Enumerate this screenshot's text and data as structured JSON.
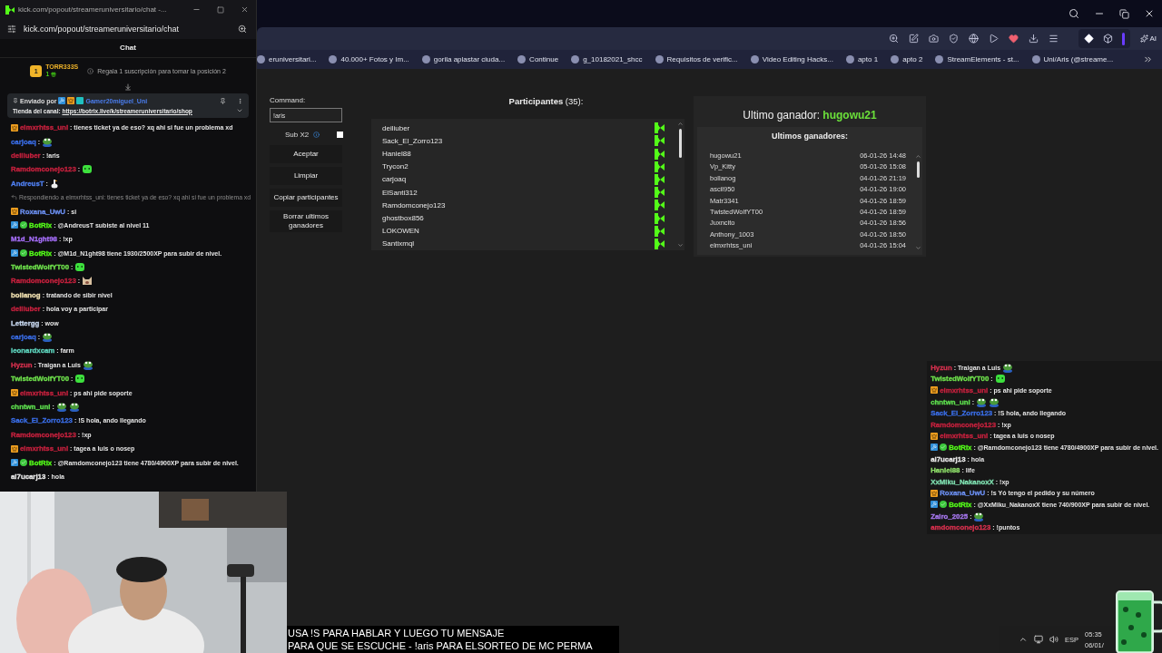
{
  "browser": {
    "ai_label": "AI",
    "bookmarks": [
      "eruniversitari...",
      "40.000+ Fotos y Im...",
      "gorila aplastar ciuda...",
      "Continue",
      "g_10182021_shcc",
      "Requisitos de verific...",
      "Video Editing Hacks...",
      "apto 1",
      "apto 2",
      "StreamElements - st...",
      "Uni/Aris (@streame..."
    ]
  },
  "panel": {
    "command_label": "Command:",
    "command_value": "!aris",
    "sub_label": "Sub X2",
    "sub_checked": false,
    "buttons": [
      "Aceptar",
      "Limpiar",
      "Copiar participantes",
      "Borrar ultimos ganadores"
    ],
    "participants_title": "**Participantes** (35):",
    "participants": [
      "deiliuber",
      "Sack_El_Zorro123",
      "Haniel88",
      "Trycon2",
      "carjoaq",
      "ElSanti312",
      "Ramdomconejo123",
      "ghostbox856",
      "LOKOWEN",
      "Santixmql"
    ],
    "winner_label": "Ultimo ganador: ",
    "winner": "hugowu21",
    "winners_title": "Ultimos ganadores:",
    "winners": [
      {
        "name": "hugowu21",
        "date": "06-01-26 14:48"
      },
      {
        "name": "Vp_Kitty",
        "date": "05-01-26 15:08"
      },
      {
        "name": "bollanog",
        "date": "04-01-26 21:19"
      },
      {
        "name": "ascil950",
        "date": "04-01-26 19:00"
      },
      {
        "name": "Matr3341",
        "date": "04-01-26 18:59"
      },
      {
        "name": "TwistedWolfYT00",
        "date": "04-01-26 18:59"
      },
      {
        "name": "Juxncito",
        "date": "04-01-26 18:56"
      },
      {
        "name": "Anthony_1003",
        "date": "04-01-26 18:50"
      },
      {
        "name": "elmxrhtss_uni",
        "date": "04-01-26 15:04"
      }
    ]
  },
  "chat_window": {
    "title": "kick.com/popout/streameruniversitario/chat -...",
    "address": "kick.com/popout/streameruniversitario/chat",
    "header": "Chat",
    "leader": {
      "rank": "1",
      "name": "TORR333S",
      "count": "1",
      "hint": "Regala 1 suscripción para tomar la posición 2"
    },
    "pinned": {
      "label": "Enviado por",
      "user": "Gamer20miguel_Uni",
      "text": "Tienda del canal: ",
      "link": "https://botrix.live/k/streameruniversitario/shop"
    },
    "messages": [
      {
        "kind": "message",
        "badges": [
          {
            "kind": "crown"
          }
        ],
        "user": "elmxrhtss_uni",
        "color": "#c8213e",
        "text": ": tienes ticket ya de eso? xq ahi si fue un problema xd"
      },
      {
        "kind": "message",
        "user": "carjoaq",
        "color": "#3a6ee8",
        "text": ":",
        "emotes": [
          {
            "kind": "frog"
          }
        ]
      },
      {
        "kind": "message",
        "user": "deiliuber",
        "color": "#c8213e",
        "text": ": !aris"
      },
      {
        "kind": "message",
        "user": "Ramdomconejo123",
        "color": "#c8213e",
        "text": ":",
        "emotes": [
          {
            "kind": "slime"
          }
        ]
      },
      {
        "kind": "message",
        "user": "AndreusT",
        "color": "#4f7ff0",
        "text": ":",
        "emotes": [
          {
            "kind": "goose"
          }
        ]
      },
      {
        "kind": "reply",
        "text": "Respondiendo a elmxrhtss_uni: tienes ticket ya de eso? xq ahi si fue un problema xd"
      },
      {
        "kind": "message",
        "badges": [
          {
            "kind": "crown"
          }
        ],
        "user": "Roxana_UwU",
        "color": "#6b8ff0",
        "text": ": si"
      },
      {
        "kind": "message",
        "badges": [
          {
            "kind": "botrix"
          },
          {
            "kind": "verified"
          }
        ],
        "user": "BotRix",
        "color": "#53fc18",
        "text": ": @AndreusT subiste al nivel 11"
      },
      {
        "kind": "message",
        "user": "M1d_N1ght98",
        "color": "#a970ff",
        "text": ": !xp"
      },
      {
        "kind": "message",
        "badges": [
          {
            "kind": "botrix"
          },
          {
            "kind": "verified"
          }
        ],
        "user": "BotRix",
        "color": "#53fc18",
        "text": ": @M1d_N1ght98 tiene 1930/2500XP para subir de nivel."
      },
      {
        "kind": "message",
        "user": "TwistedWolfYT00",
        "color": "#6fe34c",
        "text": ":",
        "emotes": [
          {
            "kind": "slime"
          }
        ]
      },
      {
        "kind": "message",
        "user": "Ramdomconejo123",
        "color": "#c8213e",
        "text": ":",
        "emotes": [
          {
            "kind": "cat"
          }
        ]
      },
      {
        "kind": "message",
        "user": "bollanog",
        "color": "#f0e0b0",
        "text": ": tratando de sibir nivel"
      },
      {
        "kind": "message",
        "user": "deiliuber",
        "color": "#c8213e",
        "text": ": hola voy a participar"
      },
      {
        "kind": "message",
        "user": "Lettergg",
        "color": "#c8d8f0",
        "text": ": wow"
      },
      {
        "kind": "message",
        "user": "carjoaq",
        "color": "#3a6ee8",
        "text": ":",
        "emotes": [
          {
            "kind": "frog"
          }
        ]
      },
      {
        "kind": "message",
        "user": "leonardxcam",
        "color": "#5fd8c0",
        "text": ": farm"
      },
      {
        "kind": "message",
        "user": "Hyzun",
        "color": "#d8304e",
        "text": ": Traigan a Luis",
        "emotes": [
          {
            "kind": "frog"
          }
        ]
      },
      {
        "kind": "message",
        "user": "TwistedWolfYT00",
        "color": "#6fe34c",
        "text": ":",
        "emotes": [
          {
            "kind": "slime"
          }
        ]
      },
      {
        "kind": "message",
        "badges": [
          {
            "kind": "crown"
          }
        ],
        "user": "elmxrhtss_uni",
        "color": "#c8213e",
        "text": ": ps ahi pide soporte"
      },
      {
        "kind": "message",
        "user": "chntwn_uni",
        "color": "#5ee04e",
        "text": ":",
        "emotes": [
          {
            "kind": "frog"
          },
          {
            "kind": "frog"
          }
        ]
      },
      {
        "kind": "message",
        "user": "Sack_El_Zorro123",
        "color": "#3a6ee8",
        "text": ": !S hola, ando llegando"
      },
      {
        "kind": "message",
        "user": "Ramdomconejo123",
        "color": "#c8213e",
        "text": ": !xp"
      },
      {
        "kind": "message",
        "badges": [
          {
            "kind": "crown"
          }
        ],
        "user": "elmxrhtss_uni",
        "color": "#c8213e",
        "text": ": tagea a luis o nosep"
      },
      {
        "kind": "message",
        "badges": [
          {
            "kind": "botrix"
          },
          {
            "kind": "verified"
          }
        ],
        "user": "BotRix",
        "color": "#53fc18",
        "text": ": @Ramdomconejo123 tiene 4780/4900XP para subir de nivel."
      },
      {
        "kind": "message",
        "user": "al7ucarj13",
        "color": "#e8e8e8",
        "text": ": hola"
      }
    ]
  },
  "overlay_chat": {
    "messages": [
      {
        "kind": "message",
        "user": "Hyzun",
        "color": "#d8304e",
        "text": " : Traigan a Luis",
        "emotes": [
          {
            "kind": "frog"
          }
        ]
      },
      {
        "kind": "message",
        "user": "TwistedWolfYT00",
        "color": "#6fe34c",
        "text": " :",
        "emotes": [
          {
            "kind": "slime"
          }
        ]
      },
      {
        "kind": "message",
        "badges": [
          {
            "kind": "crown"
          }
        ],
        "user": "elmxrhtss_uni",
        "color": "#c8213e",
        "text": " : ps ahi pide soporte"
      },
      {
        "kind": "message",
        "user": "chntwn_uni",
        "color": "#5ee04e",
        "text": " :",
        "emotes": [
          {
            "kind": "frog"
          },
          {
            "kind": "frog"
          }
        ]
      },
      {
        "kind": "message",
        "user": "Sack_El_Zorro123",
        "color": "#3a6ee8",
        "text": " : !S hola, ando llegando"
      },
      {
        "kind": "message",
        "user": "Ramdomconejo123",
        "color": "#c8213e",
        "text": " : !xp"
      },
      {
        "kind": "message",
        "badges": [
          {
            "kind": "crown"
          }
        ],
        "user": "elmxrhtss_uni",
        "color": "#c8213e",
        "text": " : tagea a luis o nosep"
      },
      {
        "kind": "message",
        "badges": [
          {
            "kind": "botrix"
          },
          {
            "kind": "verified"
          }
        ],
        "user": "BotRix",
        "color": "#53fc18",
        "text": " : @Ramdomconejo123 tiene 4780/4900XP para subir de nivel."
      },
      {
        "kind": "message",
        "user": "al7ucarj13",
        "color": "#e8e8e8",
        "text": " : hola"
      },
      {
        "kind": "message",
        "user": "Haniel88",
        "color": "#8fe06a",
        "text": " : life"
      },
      {
        "kind": "message",
        "user": "XxMiku_NakanoxX",
        "color": "#7fe0b0",
        "text": " : !xp"
      },
      {
        "kind": "message",
        "badges": [
          {
            "kind": "crown"
          }
        ],
        "user": "Roxana_UwU",
        "color": "#6b8ff0",
        "text": " : !s Yó tengo el pedido y su número"
      },
      {
        "kind": "message",
        "badges": [
          {
            "kind": "botrix"
          },
          {
            "kind": "verified"
          }
        ],
        "user": "BotRix",
        "color": "#53fc18",
        "text": " : @XxMiku_NakanoxX tiene 740/900XP para subir de nivel."
      },
      {
        "kind": "message",
        "user": "Zairo_2025",
        "color": "#a878f0",
        "text": " :",
        "emotes": [
          {
            "kind": "frog"
          }
        ]
      },
      {
        "kind": "message",
        "user": "amdomconejo123",
        "color": "#d8304e",
        "text": " : !puntos"
      }
    ]
  },
  "caption": [
    "USA !S PARA HABLAR Y LUEGO TU MENSAJE",
    "PARA QUE SE ESCUCHE - !aris PARA ELSORTEO DE MC PERMA"
  ],
  "tray": {
    "language": "ESP",
    "time": "05:35",
    "date": "06/01/"
  }
}
